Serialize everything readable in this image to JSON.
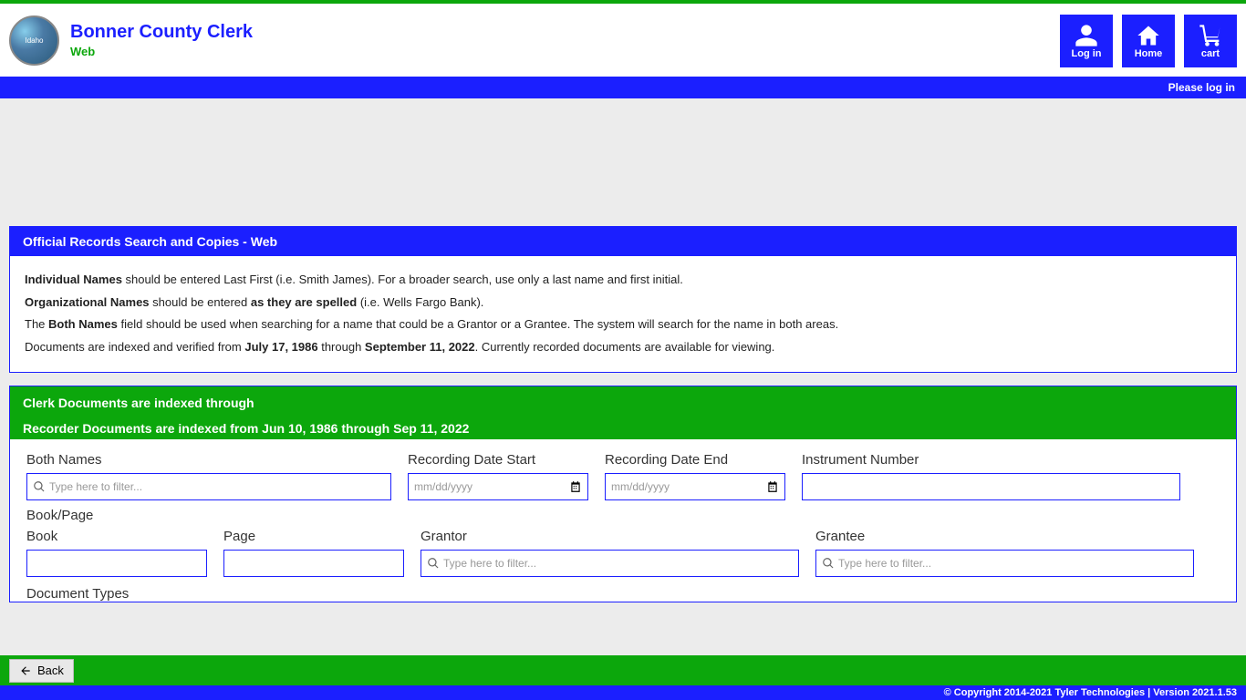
{
  "header": {
    "title": "Bonner County Clerk",
    "subtitle": "Web",
    "login": "Log in",
    "home": "Home",
    "cart": "cart",
    "please_login": "Please log in"
  },
  "panel1": {
    "title": "Official Records Search and Copies - Web",
    "l1a": "Individual Names",
    "l1b": " should be entered Last First (i.e. Smith James). For a broader search, use only a last name and first initial.",
    "l2a": "Organizational Names",
    "l2b": " should be entered ",
    "l2c": "as they are spelled",
    "l2d": " (i.e. Wells Fargo Bank).",
    "l3a": "The ",
    "l3b": "Both Names",
    "l3c": " field should be used when searching for a name that could be a Grantor or a Grantee. The system will search for the name in both areas.",
    "l4a": "Documents are indexed and verified from ",
    "l4b": "July 17, 1986",
    "l4c": " through ",
    "l4d": "September 11, 2022",
    "l4e": ". Currently recorded documents are available for viewing."
  },
  "panel2": {
    "clerk_line": "Clerk Documents are indexed through",
    "recorder_line": "Recorder Documents are indexed from Jun 10, 1986 through Sep 11, 2022"
  },
  "form": {
    "both_names": "Both Names",
    "rec_start": "Recording Date Start",
    "rec_end": "Recording Date End",
    "instr": "Instrument Number",
    "book_page": "Book/Page",
    "book": "Book",
    "page": "Page",
    "grantor": "Grantor",
    "grantee": "Grantee",
    "doc_types": "Document Types",
    "filter_ph": "Type here to filter...",
    "date_ph": "mm/dd/yyyy"
  },
  "footer": {
    "back": "Back",
    "copyright": "© Copyright 2014-2021 Tyler Technologies | Version 2021.1.53"
  }
}
